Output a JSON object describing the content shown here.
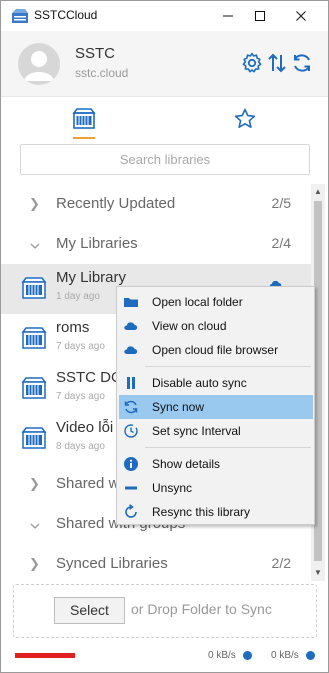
{
  "window": {
    "title": "SSTCCloud"
  },
  "account": {
    "name": "SSTC",
    "server": "sstc.cloud"
  },
  "search": {
    "placeholder": "Search libraries"
  },
  "groups": {
    "recently_updated": {
      "label": "Recently Updated",
      "count": "2/5"
    },
    "my_libraries": {
      "label": "My Libraries",
      "count": "2/4"
    },
    "shared_with_me": {
      "label": "Shared w"
    },
    "shared_with_groups": {
      "label": "Shared with groups"
    },
    "synced_libraries": {
      "label": "Synced Libraries",
      "count": "2/2"
    }
  },
  "libraries": [
    {
      "name": "My Library",
      "date": "1 day ago"
    },
    {
      "name": "roms",
      "date": "7 days ago"
    },
    {
      "name": "SSTC DO",
      "date": "7 days ago"
    },
    {
      "name": "Video lỗi",
      "date": "8 days ago"
    }
  ],
  "context_menu": {
    "items": [
      {
        "label": "Open local folder",
        "icon": "folder-icon"
      },
      {
        "label": "View on cloud",
        "icon": "cloud-icon"
      },
      {
        "label": "Open cloud file browser",
        "icon": "cloud-icon"
      },
      {
        "label": "Disable auto sync",
        "icon": "pause-icon"
      },
      {
        "label": "Sync now",
        "icon": "sync-icon",
        "highlighted": true
      },
      {
        "label": "Set sync Interval",
        "icon": "clock-icon"
      },
      {
        "label": "Show details",
        "icon": "info-icon"
      },
      {
        "label": "Unsync",
        "icon": "minus-icon"
      },
      {
        "label": "Resync this library",
        "icon": "resync-icon"
      }
    ]
  },
  "drop_area": {
    "select_label": "Select",
    "drop_text": "or Drop Folder to Sync"
  },
  "status": {
    "upload_rate": "0 kB/s",
    "download_rate": "0 kB/s"
  },
  "colors": {
    "accent_blue": "#1e6bc0",
    "menu_highlight": "#99c9ef",
    "tab_underline": "#f0a030",
    "error_bar": "#e02020"
  }
}
